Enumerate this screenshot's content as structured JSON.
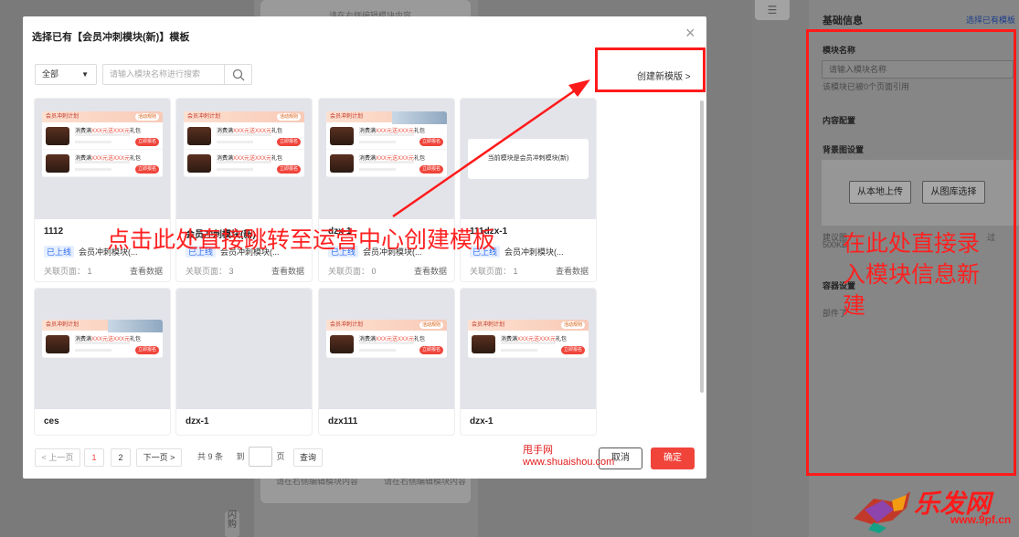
{
  "background": {
    "canvas_hint_top": "请在右侧编辑模块内容",
    "canvas_hint_bottom_1": "请在右侧编辑模块内容",
    "canvas_hint_bottom_2": "请在右侧编辑模块内容",
    "side_vertical_text": "闪购"
  },
  "right_panel": {
    "title": "基础信息",
    "select_existing_link": "选择已有模板",
    "module_name_label": "模块名称",
    "module_name_placeholder": "请输入模块名称",
    "module_name_hint": "该模块已被0个页面引用",
    "content_config_label": "内容配置",
    "bg_settings_label": "背景图设置",
    "upload_local_button": "从本地上传",
    "choose_library_button": "从图库选择",
    "bg_hint_left": "建议图",
    "bg_hint_left2": "500KB",
    "bg_hint_right": "过",
    "container_settings_label": "容器设置",
    "container_hint": "部件了"
  },
  "modal": {
    "title": "选择已有【会员冲刺模块(新)】模板",
    "close_glyph": "×",
    "filter_select_value": "全部",
    "search_placeholder": "请输入模块名称进行搜索",
    "create_new_link": "创建新模版 >",
    "templates": [
      {
        "name": "1112",
        "status": "已上线",
        "module": "会员冲刺模块(...",
        "related_label": "关联页面：",
        "related_count": "1",
        "view_data": "查看数据",
        "thumb": "banner"
      },
      {
        "name": "会员冲刺模块(新)",
        "status": "已上线",
        "module": "会员冲刺模块(...",
        "related_label": "关联页面：",
        "related_count": "3",
        "view_data": "查看数据",
        "thumb": "banner"
      },
      {
        "name": "dzx-1",
        "status": "已上线",
        "module": "会员冲刺模块(...",
        "related_label": "关联页面：",
        "related_count": "0",
        "view_data": "查看数据",
        "thumb": "banner-person"
      },
      {
        "name": "111dzx-1",
        "status": "已上线",
        "module": "会员冲刺模块(...",
        "related_label": "关联页面：",
        "related_count": "1",
        "view_data": "查看数据",
        "thumb": "placeholder"
      },
      {
        "name": "ces",
        "thumb": "banner-person-single"
      },
      {
        "name": "dzx-1",
        "thumb": "empty"
      },
      {
        "name": "dzx111",
        "thumb": "banner-single"
      },
      {
        "name": "dzx-1",
        "thumb": "banner-single"
      }
    ],
    "placeholder_text": "当前模块是会员冲刺模块(新)",
    "thumb_head": "会员冲刺计划",
    "thumb_head_badge": "活动规则",
    "thumb_product_title_a": "消费满",
    "thumb_product_title_b": "XXX元送XXX元",
    "thumb_product_title_c": "礼包",
    "thumb_button": "立即报名",
    "pagination": {
      "prev": "< 上一页",
      "page1": "1",
      "page2": "2",
      "next": "下一页 >",
      "total": "共 9 条",
      "goto": "到",
      "page_unit": "页",
      "confirm": "查询"
    },
    "cancel_button": "取消",
    "ok_button": "确定"
  },
  "annotations": {
    "left_note": "点击此处直接跳转至运营中心创建模板",
    "right_note_1": "在此处直接录",
    "right_note_2": "入模块信息新",
    "right_note_3": "建",
    "watermark_1": "甩手网",
    "watermark_2": "www.shuaishou.com",
    "logo_text": "乐发网",
    "logo_url": "www.9pf.cn",
    "annotation_color": "#ff1a1a"
  }
}
